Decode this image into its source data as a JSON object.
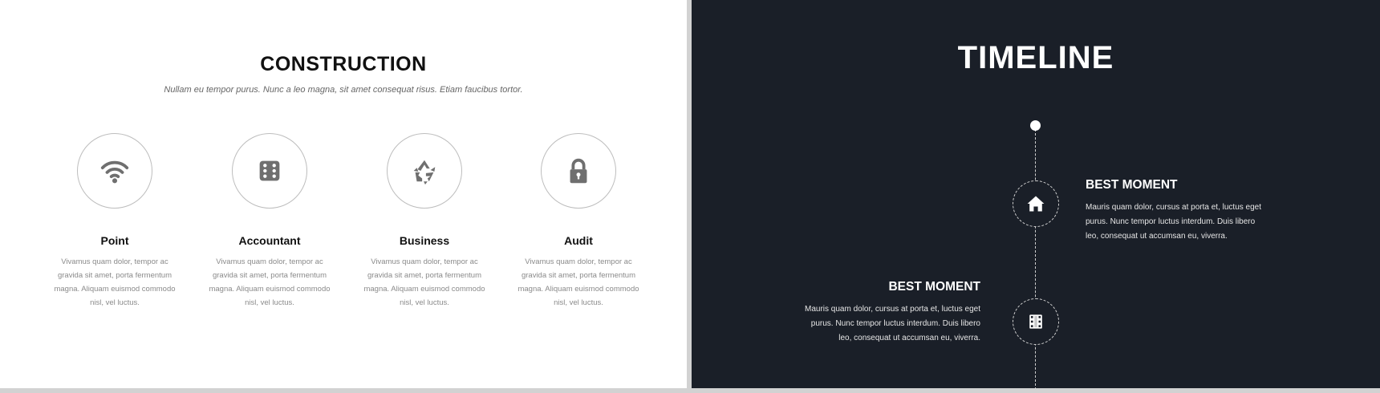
{
  "left": {
    "title": "CONSTRUCTION",
    "subtitle": "Nullam eu tempor purus. Nunc a leo magna, sit amet consequat risus. Etiam faucibus tortor.",
    "features": [
      {
        "icon": "wifi-icon",
        "title": "Point",
        "text": "Vivamus quam dolor, tempor ac gravida sit amet, porta fermentum magna. Aliquam euismod commodo nisl, vel luctus."
      },
      {
        "icon": "dice-icon",
        "title": "Accountant",
        "text": "Vivamus quam dolor, tempor ac gravida sit amet, porta fermentum magna. Aliquam euismod commodo nisl, vel luctus."
      },
      {
        "icon": "recycle-icon",
        "title": "Business",
        "text": "Vivamus quam dolor, tempor ac gravida sit amet, porta fermentum magna. Aliquam euismod commodo nisl, vel luctus."
      },
      {
        "icon": "lock-icon",
        "title": "Audit",
        "text": "Vivamus quam dolor, tempor ac gravida sit amet, porta fermentum magna. Aliquam euismod commodo nisl, vel luctus."
      }
    ]
  },
  "right": {
    "title": "TIMELINE",
    "items": [
      {
        "icon": "home-icon",
        "title": "BEST MOMENT",
        "text": "Mauris quam dolor, cursus at porta et, luctus eget purus. Nunc tempor luctus interdum. Duis libero leo, consequat ut accumsan eu, viverra."
      },
      {
        "icon": "film-icon",
        "title": "BEST MOMENT",
        "text": "Mauris quam dolor, cursus at porta et, luctus eget purus. Nunc tempor luctus interdum. Duis libero leo, consequat ut accumsan eu, viverra."
      }
    ]
  },
  "colors": {
    "dark_bg": "#1a1f28",
    "icon_gray": "#6f6f6f",
    "circle_border": "#bdbdbd"
  }
}
